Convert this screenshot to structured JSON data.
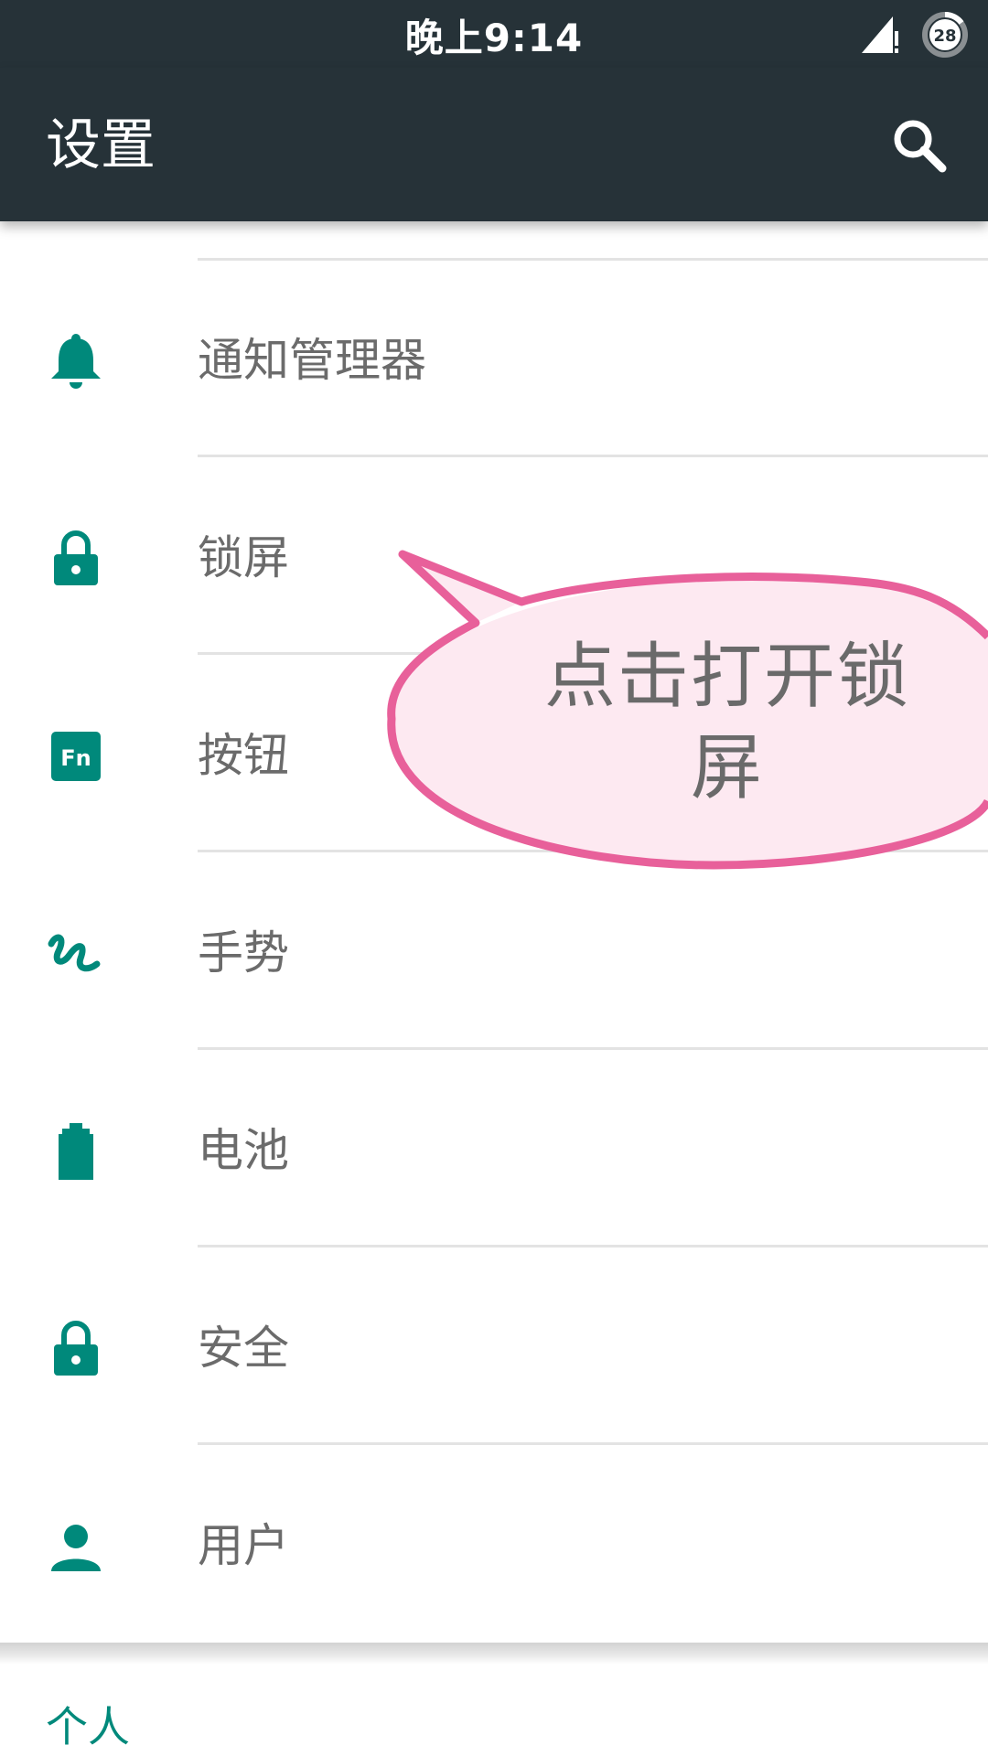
{
  "status_bar": {
    "time": "晚上9:14",
    "battery_level": "28",
    "signal_icon": "signal-no-data-icon",
    "battery_icon": "battery-ring-icon"
  },
  "app_bar": {
    "title": "设置",
    "search_icon": "search-icon"
  },
  "settings_items": [
    {
      "label": "通知管理器",
      "icon": "bell-icon"
    },
    {
      "label": "锁屏",
      "icon": "lock-icon"
    },
    {
      "label": "按钮",
      "icon": "fn-key-icon"
    },
    {
      "label": "手势",
      "icon": "gesture-icon"
    },
    {
      "label": "电池",
      "icon": "battery-icon"
    },
    {
      "label": "安全",
      "icon": "lock-icon"
    },
    {
      "label": "用户",
      "icon": "person-icon"
    }
  ],
  "section": {
    "title": "个人"
  },
  "callout": {
    "text": "点击打开锁屏"
  },
  "colors": {
    "app_bar_bg": "#263238",
    "accent_teal": "#00897b",
    "callout_border": "#e8609a",
    "callout_fill": "#fde9f1"
  }
}
